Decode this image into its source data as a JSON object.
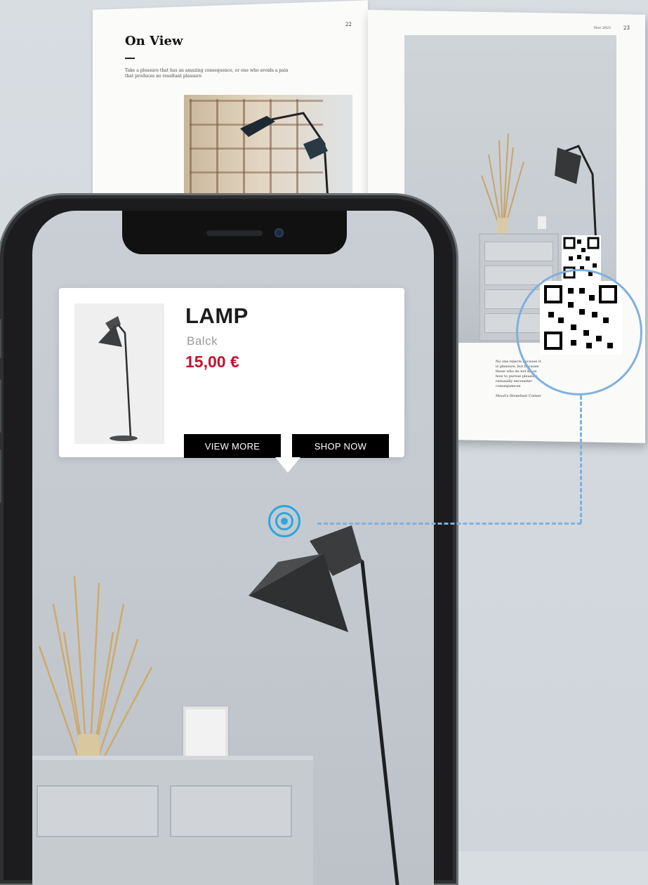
{
  "magazine": {
    "heading": "On View",
    "body_text": "Take a pleasure that has an amazing consequence, or one who avoids a pain that produces no resultant pleasure",
    "page_left_number": "22",
    "page_right_number": "23",
    "page_date": "Nov 2021",
    "caption": "No one rejects because it is pleasure, but because those who do not know how to pursue pleasure rationally encounter consequences",
    "caption_credit": "Mood's Stoneliest Corner"
  },
  "product_card": {
    "title": "LAMP",
    "color_variant": "Balck",
    "price": "15,00 €",
    "view_more_label": "VIEW MORE",
    "shop_now_label": "SHOP NOW"
  },
  "colors": {
    "accent_blue": "#2aa6e0",
    "dash_blue": "#7fb0de",
    "price_red": "#c41230"
  },
  "icons": {
    "ar_marker": "target-icon",
    "qr_codes": "qr-code-icon"
  }
}
